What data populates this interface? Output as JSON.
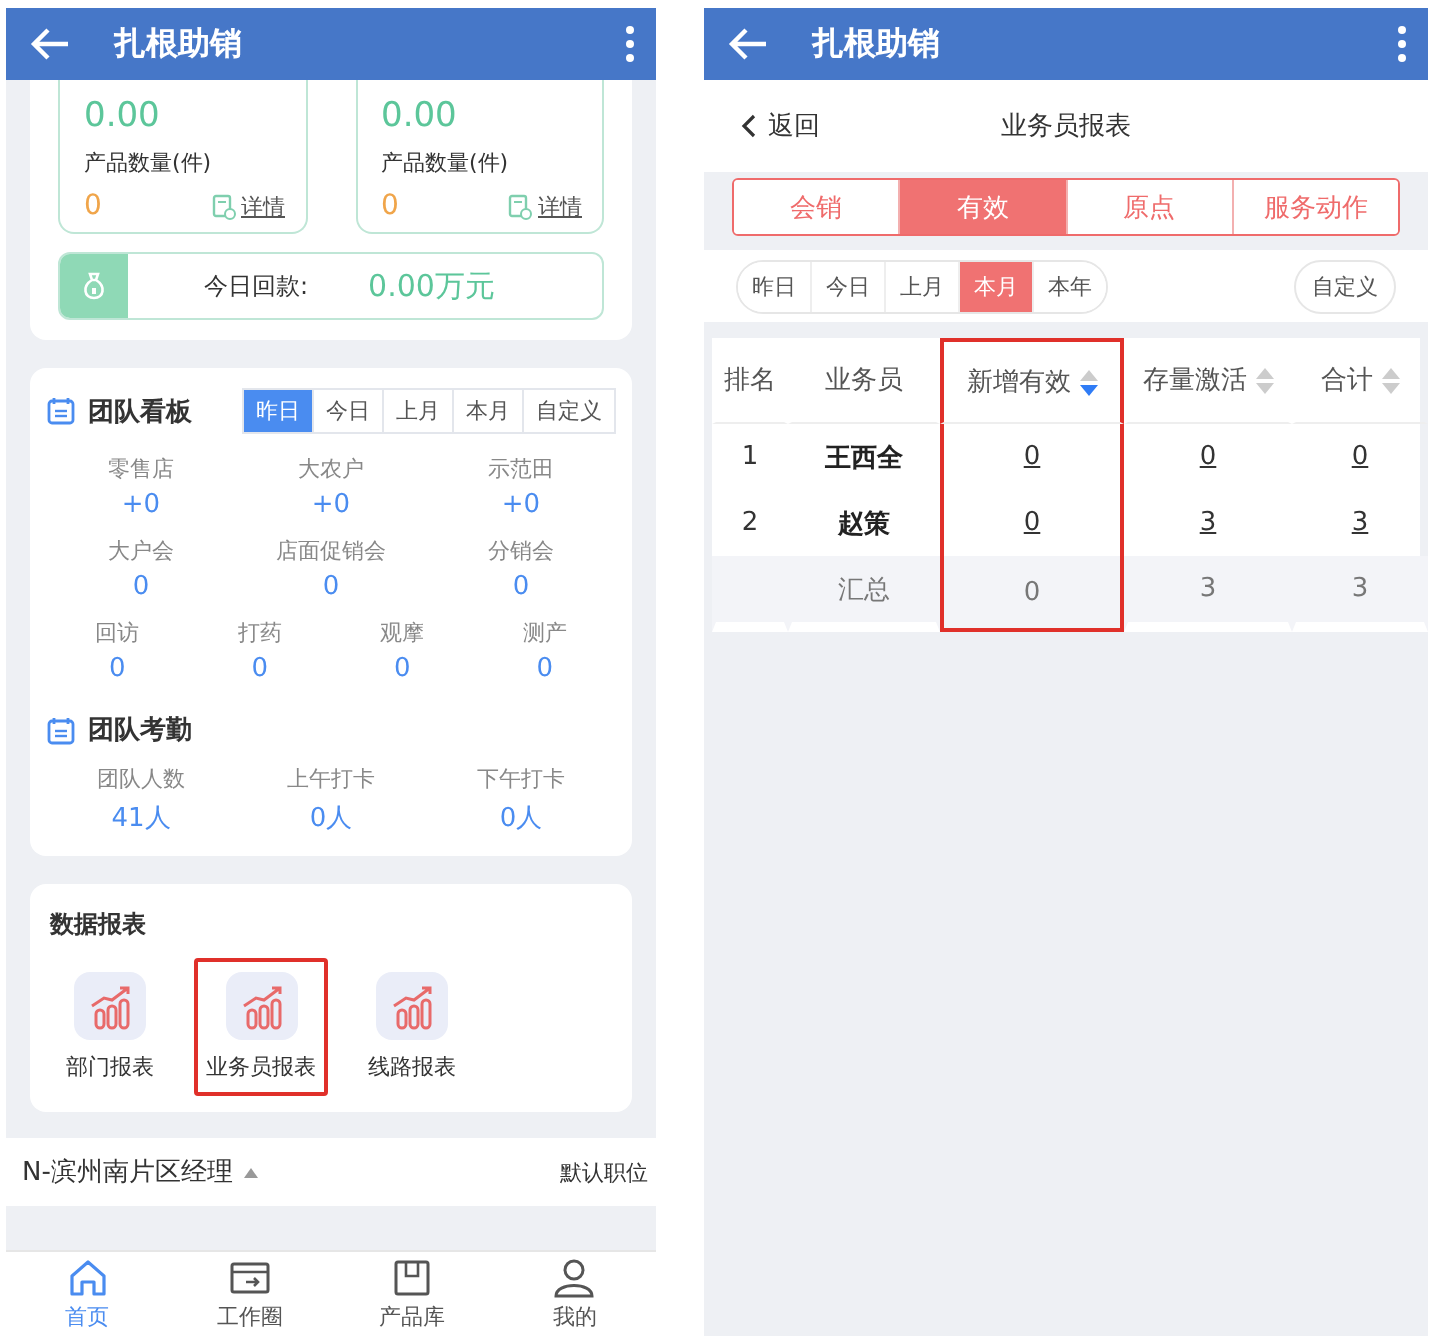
{
  "home_screen": {
    "app_bar": {
      "title": "扎根助销"
    },
    "stat_cards": [
      {
        "value": "0.00",
        "count_label": "产品数量(件)",
        "count": "0",
        "link": "详情"
      },
      {
        "value": "0.00",
        "count_label": "产品数量(件)",
        "count": "0",
        "link": "详情"
      }
    ],
    "today_payment": {
      "label": "今日回款:",
      "value": "0.00万元"
    },
    "team_board": {
      "title": "团队看板",
      "periods": [
        {
          "label": "昨日",
          "selected": true
        },
        {
          "label": "今日",
          "selected": false
        },
        {
          "label": "上月",
          "selected": false
        },
        {
          "label": "本月",
          "selected": false
        },
        {
          "label": "自定义",
          "selected": false
        }
      ],
      "metric_rows": [
        [
          {
            "label": "零售店",
            "value": "+0"
          },
          {
            "label": "大农户",
            "value": "+0"
          },
          {
            "label": "示范田",
            "value": "+0"
          }
        ],
        [
          {
            "label": "大户会",
            "value": "0"
          },
          {
            "label": "店面促销会",
            "value": "0"
          },
          {
            "label": "分销会",
            "value": "0"
          }
        ],
        [
          {
            "label": "回访",
            "value": "0"
          },
          {
            "label": "打药",
            "value": "0"
          },
          {
            "label": "观摩",
            "value": "0"
          },
          {
            "label": "测产",
            "value": "0"
          }
        ]
      ]
    },
    "team_attendance": {
      "title": "团队考勤",
      "metrics": [
        {
          "label": "团队人数",
          "value": "41人"
        },
        {
          "label": "上午打卡",
          "value": "0人"
        },
        {
          "label": "下午打卡",
          "value": "0人"
        }
      ]
    },
    "data_reports": {
      "title": "数据报表",
      "items": [
        {
          "label": "部门报表",
          "highlighted": false
        },
        {
          "label": "业务员报表",
          "highlighted": true
        },
        {
          "label": "线路报表",
          "highlighted": false
        }
      ]
    },
    "position_bar": {
      "name": "N-滨州南片区经理",
      "action": "默认职位"
    },
    "bottom_nav": [
      {
        "kind": "home",
        "label": "首页",
        "selected": true
      },
      {
        "kind": "work",
        "label": "工作圈",
        "selected": false
      },
      {
        "kind": "product",
        "label": "产品库",
        "selected": false
      },
      {
        "kind": "user",
        "label": "我的",
        "selected": false
      }
    ]
  },
  "report_screen": {
    "app_bar": {
      "title": "扎根助销"
    },
    "back": "返回",
    "title": "业务员报表",
    "category_tabs": [
      {
        "label": "会销",
        "selected": false
      },
      {
        "label": "有效",
        "selected": true
      },
      {
        "label": "原点",
        "selected": false
      },
      {
        "label": "服务动作",
        "selected": false
      }
    ],
    "periods": [
      {
        "label": "昨日",
        "selected": false
      },
      {
        "label": "今日",
        "selected": false
      },
      {
        "label": "上月",
        "selected": false
      },
      {
        "label": "本月",
        "selected": true
      },
      {
        "label": "本年",
        "selected": false
      }
    ],
    "custom_period": "自定义",
    "table": {
      "columns": [
        {
          "label": "排名",
          "sortable": false,
          "highlighted": false
        },
        {
          "label": "业务员",
          "sortable": false,
          "highlighted": false
        },
        {
          "label": "新增有效",
          "sortable": true,
          "sorted_desc": true,
          "highlighted": true
        },
        {
          "label": "存量激活",
          "sortable": true,
          "sorted_desc": false,
          "highlighted": false
        },
        {
          "label": "合计",
          "sortable": true,
          "sorted_desc": false,
          "highlighted": false
        }
      ],
      "rows": [
        {
          "rank": "1",
          "name": "王西全",
          "values": [
            "0",
            "0",
            "0"
          ]
        },
        {
          "rank": "2",
          "name": "赵策",
          "values": [
            "0",
            "3",
            "3"
          ]
        }
      ],
      "total": {
        "label": "汇总",
        "values": [
          "0",
          "3",
          "3"
        ]
      }
    }
  }
}
